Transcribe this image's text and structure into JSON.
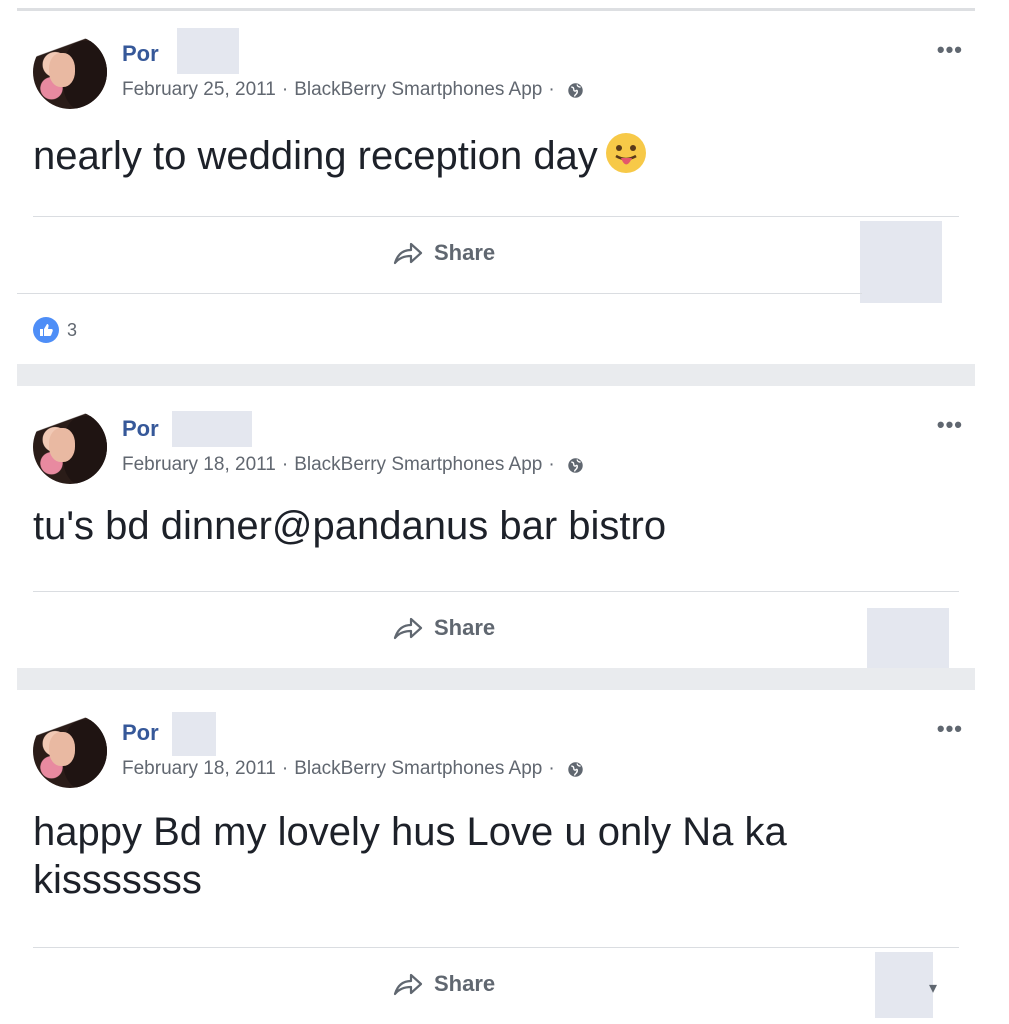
{
  "posts": [
    {
      "author": "Por",
      "date": "February 25, 2011",
      "source": "BlackBerry Smartphones App",
      "text": "nearly to wedding reception day",
      "share_label": "Share",
      "like_count": "3"
    },
    {
      "author": "Por",
      "date": "February 18, 2011",
      "source": "BlackBerry Smartphones App",
      "text": "tu's bd dinner@pandanus bar bistro",
      "share_label": "Share"
    },
    {
      "author": "Por",
      "date": "February 18, 2011",
      "source": "BlackBerry Smartphones App",
      "text": "happy Bd my lovely hus Love u only Na ka kisssssss",
      "share_label": "Share"
    }
  ],
  "icons": {
    "more": "more-options-icon",
    "globe": "globe-icon",
    "share": "share-arrow-icon",
    "like": "like-thumb-icon",
    "emoji": "tongue-out-emoji"
  },
  "colors": {
    "author_link": "#365899",
    "like_blue": "#4e8ef7",
    "feed_gap": "#e9ebee"
  }
}
